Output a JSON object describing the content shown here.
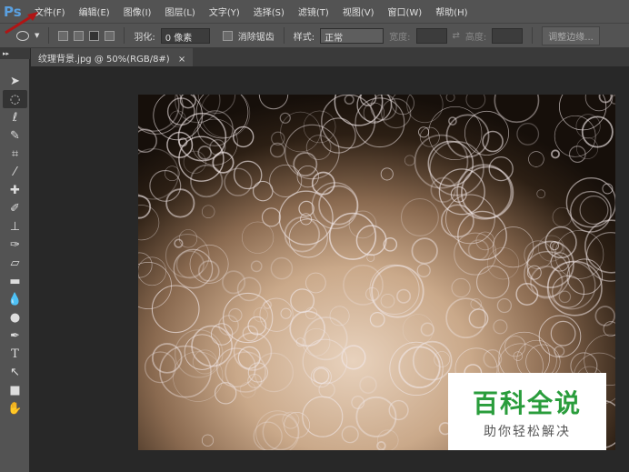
{
  "app": {
    "logo": "Ps"
  },
  "menu": [
    "文件(F)",
    "编辑(E)",
    "图像(I)",
    "图层(L)",
    "文字(Y)",
    "选择(S)",
    "滤镜(T)",
    "视图(V)",
    "窗口(W)",
    "帮助(H)"
  ],
  "options": {
    "feather_label": "羽化:",
    "feather_value": "0 像素",
    "antialias_label": "消除锯齿",
    "style_label": "样式:",
    "style_value": "正常",
    "width_label": "宽度:",
    "height_label": "高度:",
    "refine_button": "调整边缘..."
  },
  "document": {
    "tab_title": "纹理背景.jpg @ 50%(RGB/8#)",
    "close": "×"
  },
  "watermark": {
    "title": "百科全说",
    "subtitle": "助你轻松解决"
  }
}
